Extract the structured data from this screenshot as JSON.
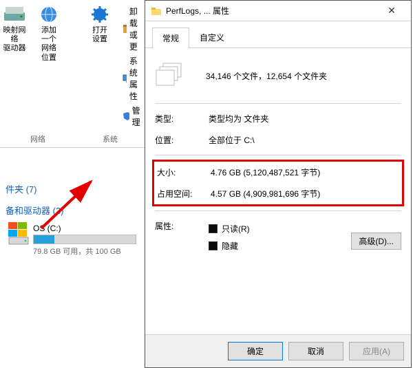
{
  "explorer": {
    "ribbon": {
      "map_drive": "映射网络\n驱动器",
      "add_location": "添加一个\n网络位置",
      "open_settings": "打开\n设置",
      "uninstall": "卸载或更",
      "sys_props": "系统属性",
      "manage": "管理",
      "group_network": "网络",
      "group_system": "系统"
    },
    "folders_header": "件夹 (7)",
    "drives_header": "备和驱动器 (3)",
    "drive": {
      "name": "OS (C:)",
      "text": "79.8 GB 可用，共 100 GB"
    }
  },
  "dialog": {
    "title": "PerfLogs, ... 属性",
    "tabs": {
      "general": "常规",
      "custom": "自定义"
    },
    "files_summary": "34,146 个文件，12,654 个文件夹",
    "labels": {
      "type": "类型:",
      "location": "位置:",
      "size": "大小:",
      "size_on_disk": "占用空间:",
      "attributes": "属性:"
    },
    "values": {
      "type": "类型均为 文件夹",
      "location": "全部位于 C:\\",
      "size": "4.76 GB (5,120,487,521 字节)",
      "size_on_disk": "4.57 GB (4,909,981,696 字节)"
    },
    "checkboxes": {
      "readonly": "只读(R)",
      "hidden": "隐藏"
    },
    "advanced": "高级(D)...",
    "buttons": {
      "ok": "确定",
      "cancel": "取消",
      "apply": "应用(A)"
    }
  }
}
